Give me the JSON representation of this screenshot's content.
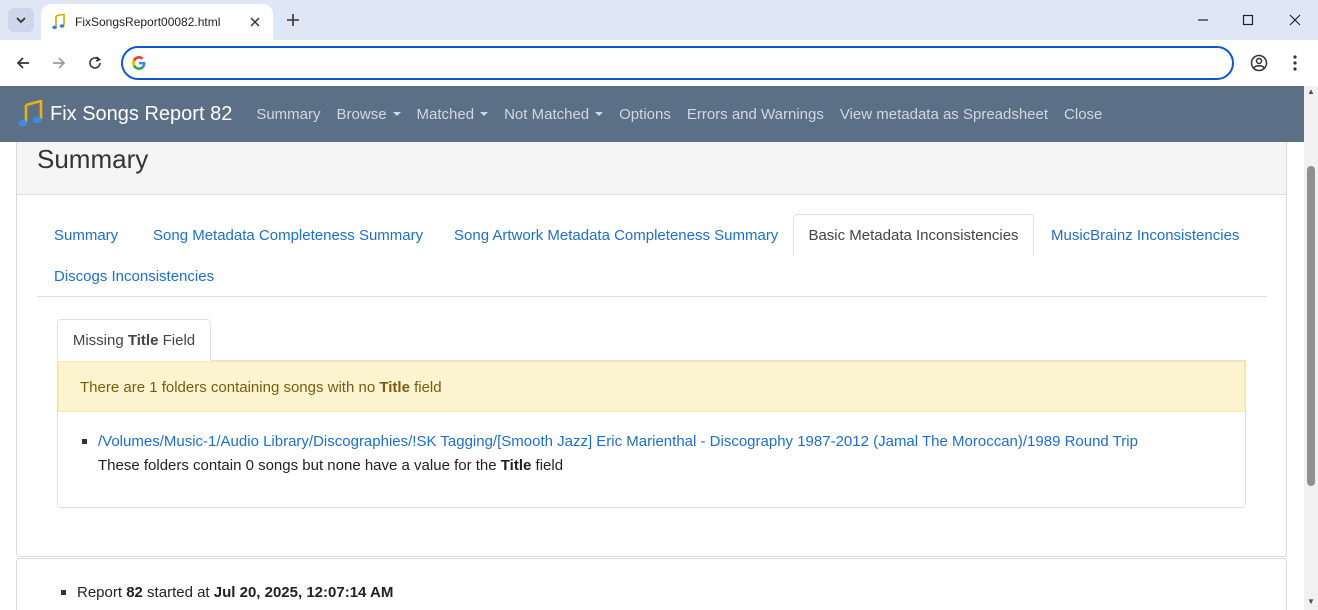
{
  "browser": {
    "tab_title": "FixSongsReport00082.html",
    "omnibox_value": ""
  },
  "navbar": {
    "brand": "Fix Songs Report 82",
    "items": [
      "Summary",
      "Browse",
      "Matched",
      "Not Matched",
      "Options",
      "Errors and Warnings",
      "View metadata as Spreadsheet",
      "Close"
    ]
  },
  "card": {
    "title": "Summary",
    "tabs": [
      "Summary",
      "Song Metadata Completeness Summary",
      "Song Artwork Metadata Completeness Summary",
      "Basic Metadata Inconsistencies",
      "MusicBrainz Inconsistencies",
      "Discogs Inconsistencies"
    ],
    "active_tab": "Basic Metadata Inconsistencies",
    "subtab": {
      "pre": "Missing ",
      "bold": "Title",
      "post": " Field"
    },
    "alert": {
      "pre": "There are 1 folders containing songs with no ",
      "bold": "Title",
      "post": " field"
    },
    "folder": {
      "path": "/Volumes/Music-1/Audio Library/Discographies/!SK Tagging/[Smooth Jazz] Eric Marienthal - Discography 1987-2012 (Jamal The Moroccan)/1989 Round Trip",
      "desc_pre": "These folders contain 0 songs but none have a value for the ",
      "desc_bold": "Title",
      "desc_post": " field"
    }
  },
  "report": {
    "pre": "Report ",
    "number": "82",
    "mid": " started at ",
    "datetime": "Jul 20, 2025, 12:07:14 AM"
  },
  "colors": {
    "navbar_bg": "#5b6f87",
    "link": "#1f6fc5",
    "alert_bg": "#fcf3cf",
    "omnibox_border": "#0b57d0"
  }
}
